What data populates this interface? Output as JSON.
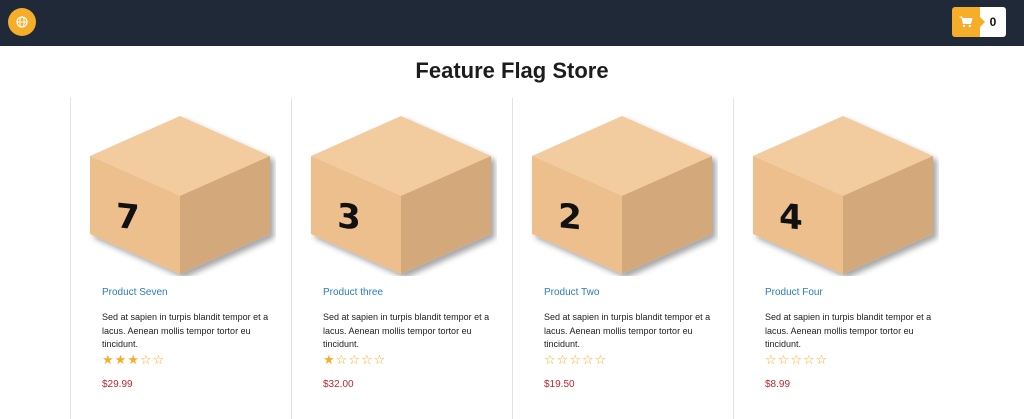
{
  "header": {
    "cart_count": "0",
    "accent": "#f6ad29",
    "bg": "#1f2937"
  },
  "page": {
    "title": "Feature Flag Store"
  },
  "products": [
    {
      "name": "Product Seven",
      "box_number": "7",
      "description": "Sed at sapien in turpis blandit tempor et a lacus. Aenean mollis tempor tortor eu tincidunt.",
      "rating": 3,
      "price": "$29.99"
    },
    {
      "name": "Product three",
      "box_number": "3",
      "description": "Sed at sapien in turpis blandit tempor et a lacus. Aenean mollis tempor tortor eu tincidunt.",
      "rating": 1,
      "price": "$32.00"
    },
    {
      "name": "Product Two",
      "box_number": "2",
      "description": "Sed at sapien in turpis blandit tempor et a lacus. Aenean mollis tempor tortor eu tincidunt.",
      "rating": 0,
      "price": "$19.50"
    },
    {
      "name": "Product Four",
      "box_number": "4",
      "description": "Sed at sapien in turpis blandit tempor et a lacus. Aenean mollis tempor tortor eu tincidunt.",
      "rating": 0,
      "price": "$8.99"
    }
  ]
}
